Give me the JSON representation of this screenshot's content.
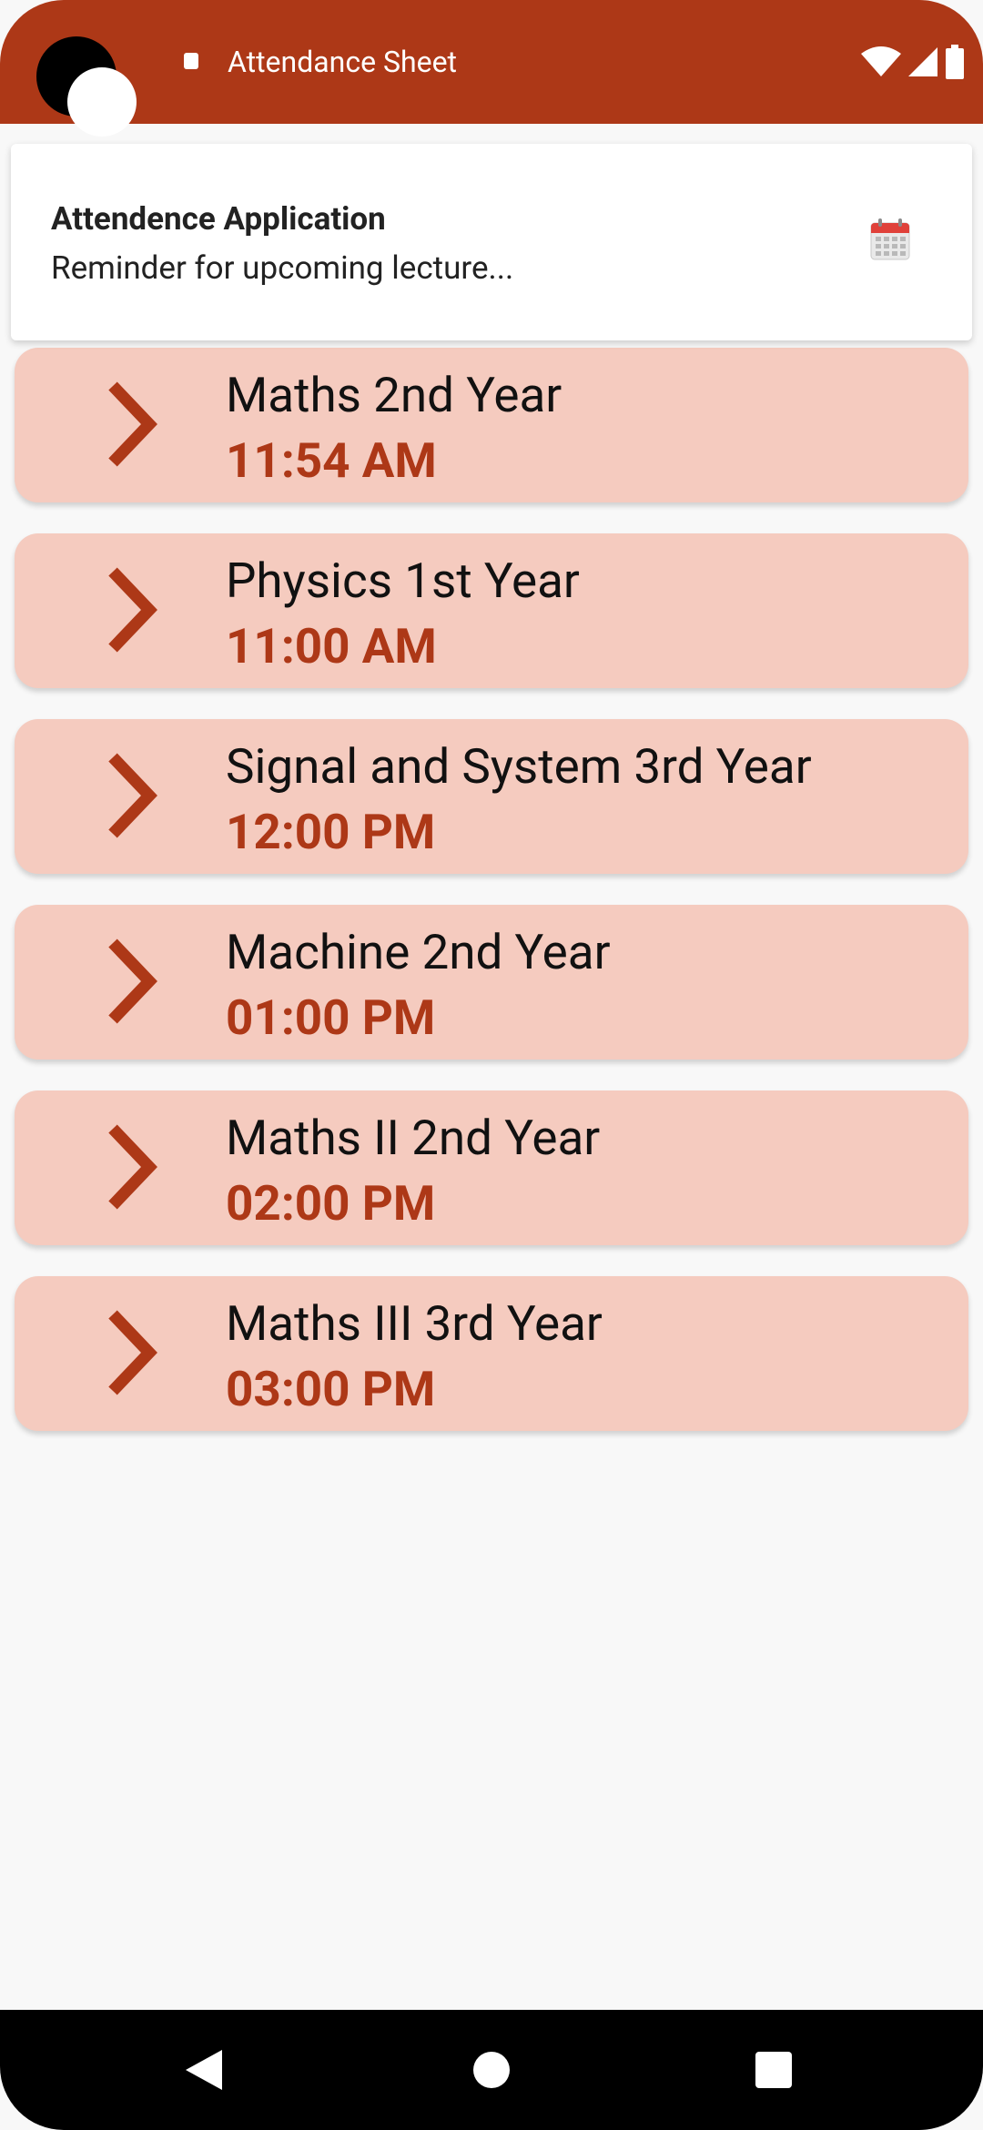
{
  "status_bar": {
    "title": "Attendance Sheet",
    "icons": [
      "notification-icon",
      "wifi-icon",
      "signal-icon",
      "battery-icon"
    ],
    "background_color": "#ad3817"
  },
  "notification": {
    "title": "Attendence Application",
    "text": "Reminder for upcoming lecture...",
    "icon": "calendar-icon"
  },
  "lectures": [
    {
      "name": "Maths 2nd Year",
      "time": "11:54 AM"
    },
    {
      "name": "Physics 1st Year",
      "time": "11:00 AM"
    },
    {
      "name": "Signal and System 3rd Year",
      "time": "12:00 PM"
    },
    {
      "name": "Machine 2nd Year",
      "time": "01:00 PM"
    },
    {
      "name": "Maths II 2nd Year",
      "time": "02:00 PM"
    },
    {
      "name": "Maths III 3rd Year",
      "time": "03:00 PM"
    }
  ],
  "theme": {
    "accent": "#ad3817",
    "card_background": "#f5cbbf",
    "page_background": "#f8f8f8"
  },
  "nav_bar": {
    "buttons": [
      "back-icon",
      "home-icon",
      "recents-icon"
    ]
  }
}
